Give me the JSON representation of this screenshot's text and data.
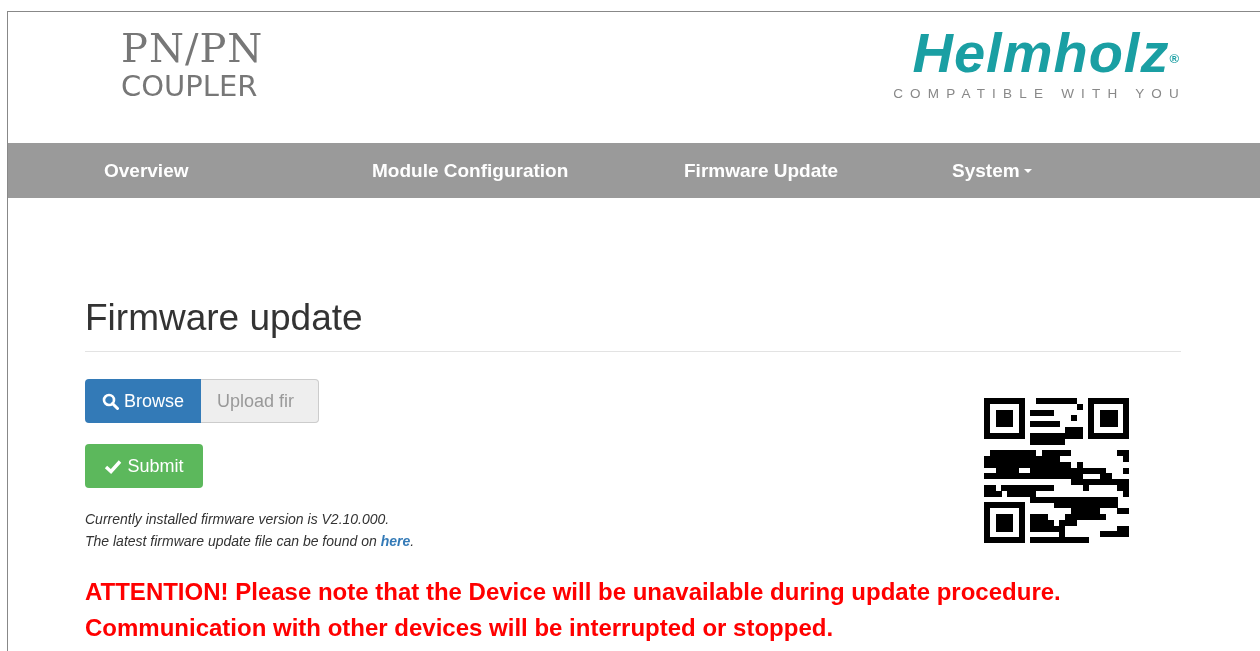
{
  "header": {
    "product_line1": "PN/PN",
    "product_line2": "COUPLER",
    "brand": "Helmholz$^{®}$",
    "brand_tagline": "COMPATIBLE WITH YOU"
  },
  "nav": [
    {
      "label": "Overview",
      "dropdown": false
    },
    {
      "label": "Module Configuration",
      "dropdown": false
    },
    {
      "label": "Firmware Update",
      "dropdown": false
    },
    {
      "label": "System",
      "dropdown": true
    }
  ],
  "page": {
    "title": "Firmware update",
    "browse_button": "Browse",
    "file_field": {
      "placeholder": "Upload fir"
    },
    "submit_button": "Submit",
    "version_note": "Currently installed firmware version is V2.10.000.",
    "download_note": {
      "before": "The latest firmware update file can be found on ",
      "link": "here",
      "after": "."
    },
    "warning_lines": [
      "ATTENTION! Please note that the Device will be unavailable during update procedure.",
      "Communication with other devices will be interrupted or stopped."
    ]
  }
}
